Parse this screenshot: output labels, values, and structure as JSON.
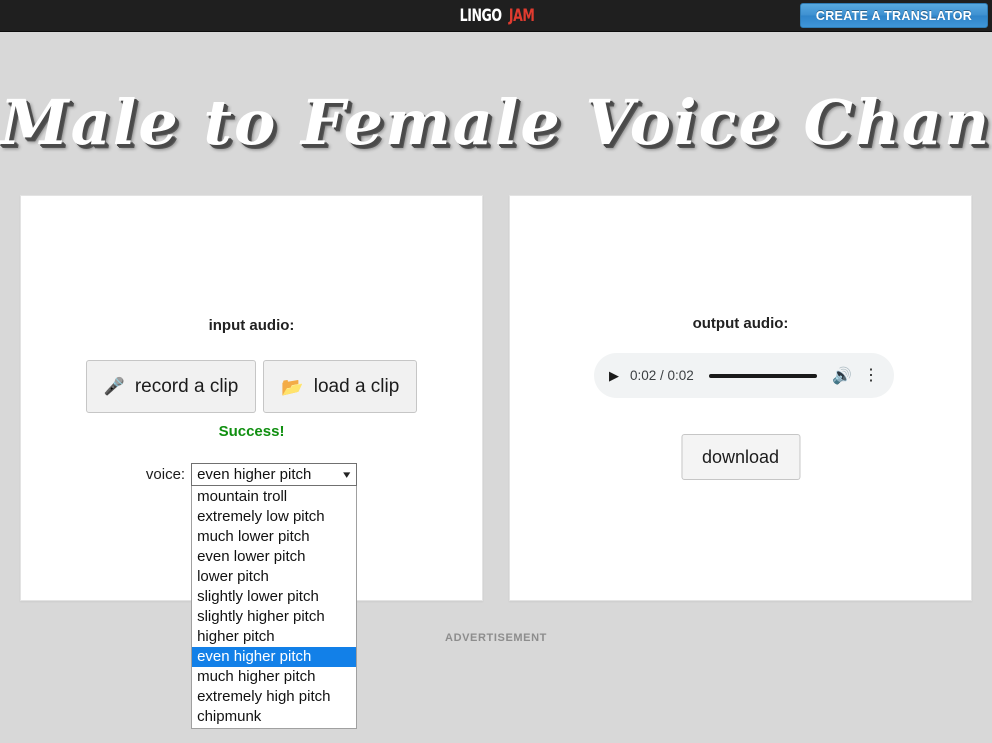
{
  "topbar": {
    "logo_primary": "LINGO",
    "logo_accent": "JAM",
    "logo_accent_color": "#e03b2f",
    "create_button": "CREATE A TRANSLATOR",
    "create_button_color": "#3d8fd0"
  },
  "page": {
    "title": "Male to Female Voice Changer",
    "ad_label": "ADVERTISEMENT"
  },
  "input_panel": {
    "label": "input audio:",
    "record_button": "record a clip",
    "record_icon": "microphone-icon",
    "load_button": "load a clip",
    "load_icon": "folder-icon",
    "status": "Success!",
    "status_color": "#108f10",
    "voice_label": "voice:",
    "voice_selected": "even higher pitch",
    "voice_options": [
      "mountain troll",
      "extremely low pitch",
      "much lower pitch",
      "even lower pitch",
      "lower pitch",
      "slightly lower pitch",
      "slightly higher pitch",
      "higher pitch",
      "even higher pitch",
      "much higher pitch",
      "extremely high pitch",
      "chipmunk"
    ],
    "highlight_color": "#1280e8"
  },
  "output_panel": {
    "label": "output audio:",
    "player": {
      "play_icon": "play-icon",
      "time": "0:02 / 0:02",
      "current_time": "0:02",
      "duration": "0:02",
      "volume_icon": "volume-icon",
      "menu_icon": "more-options-icon",
      "progress_percent": 100
    },
    "download_button": "download"
  }
}
